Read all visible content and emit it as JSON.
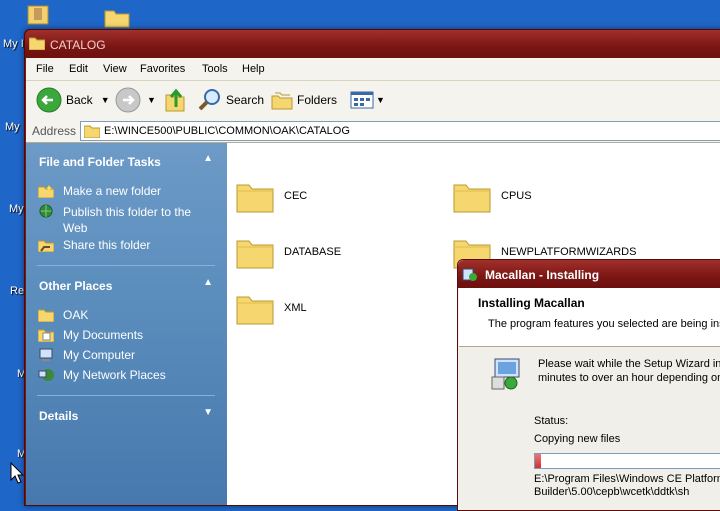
{
  "desktop": {
    "labels": [
      "My I",
      "My",
      "My",
      "Re",
      "M",
      "",
      "M"
    ]
  },
  "window": {
    "title": "CATALOG",
    "menu": [
      "File",
      "Edit",
      "View",
      "Favorites",
      "Tools",
      "Help"
    ],
    "toolbar": {
      "back": "Back",
      "search": "Search",
      "folders": "Folders"
    },
    "address": {
      "label": "Address",
      "value": "E:\\WINCE500\\PUBLIC\\COMMON\\OAK\\CATALOG"
    }
  },
  "taskpane": {
    "file_tasks": {
      "heading": "File and Folder Tasks",
      "items": [
        "Make a new folder",
        "Publish this folder to the Web",
        "Share this folder"
      ]
    },
    "other_places": {
      "heading": "Other Places",
      "items": [
        "OAK",
        "My Documents",
        "My Computer",
        "My Network Places"
      ]
    },
    "details": {
      "heading": "Details"
    }
  },
  "folders": [
    "CEC",
    "CPUS",
    "DATABASE",
    "NEWPLATFORMWIZARDS",
    "XML"
  ],
  "installer": {
    "title": "Macallan - Installing",
    "heading": "Installing Macallan",
    "subtitle": "The program features you selected are being ins",
    "wait_line1": "Please wait while the Setup Wizard ins",
    "wait_line2": "minutes to over an hour depending on",
    "status_label": "Status:",
    "status_value": "Copying new files",
    "progress": 0.03,
    "path_line1": "E:\\Program Files\\Windows CE Platform",
    "path_line2": "Builder\\5.00\\cepb\\wcetk\\ddtk\\sh"
  },
  "colors": {
    "desktop": "#1f66c9",
    "titlebar": "#7a1614",
    "taskpane": "#5a8dbc",
    "folder": "#f5d66f"
  }
}
